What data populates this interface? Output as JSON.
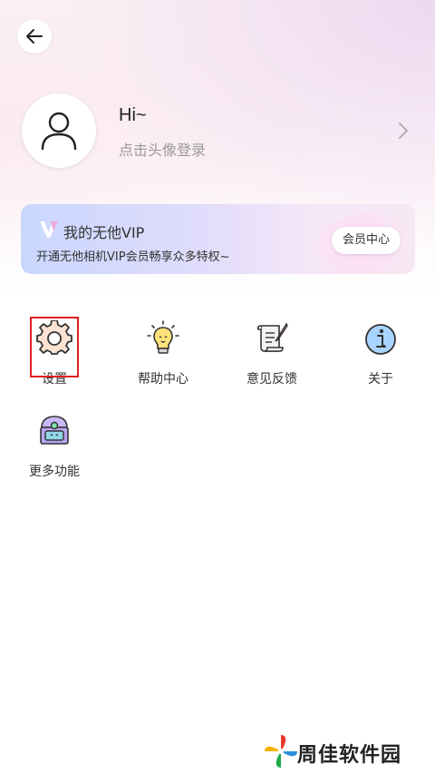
{
  "header": {
    "back_icon": "back-arrow-icon"
  },
  "profile": {
    "greeting": "Hi~",
    "login_hint": "点击头像登录",
    "avatar_icon": "user-icon",
    "chevron_icon": "chevron-right-icon"
  },
  "vip": {
    "logo_icon": "vip-v-logo-icon",
    "title": "我的无他VIP",
    "description": "开通无他相机VIP会员畅享众多特权~",
    "button_label": "会员中心",
    "gradient_start": "#c9d7ff",
    "gradient_end": "#f7e9f4"
  },
  "menu": {
    "items": [
      {
        "label": "设置",
        "icon": "gear-icon"
      },
      {
        "label": "帮助中心",
        "icon": "lightbulb-icon"
      },
      {
        "label": "意见反馈",
        "icon": "scroll-quill-icon"
      },
      {
        "label": "关于",
        "icon": "info-icon"
      },
      {
        "label": "更多功能",
        "icon": "treasure-chest-icon"
      }
    ],
    "highlight_color": "#e02020"
  },
  "watermark": {
    "text": "周佳软件园"
  }
}
